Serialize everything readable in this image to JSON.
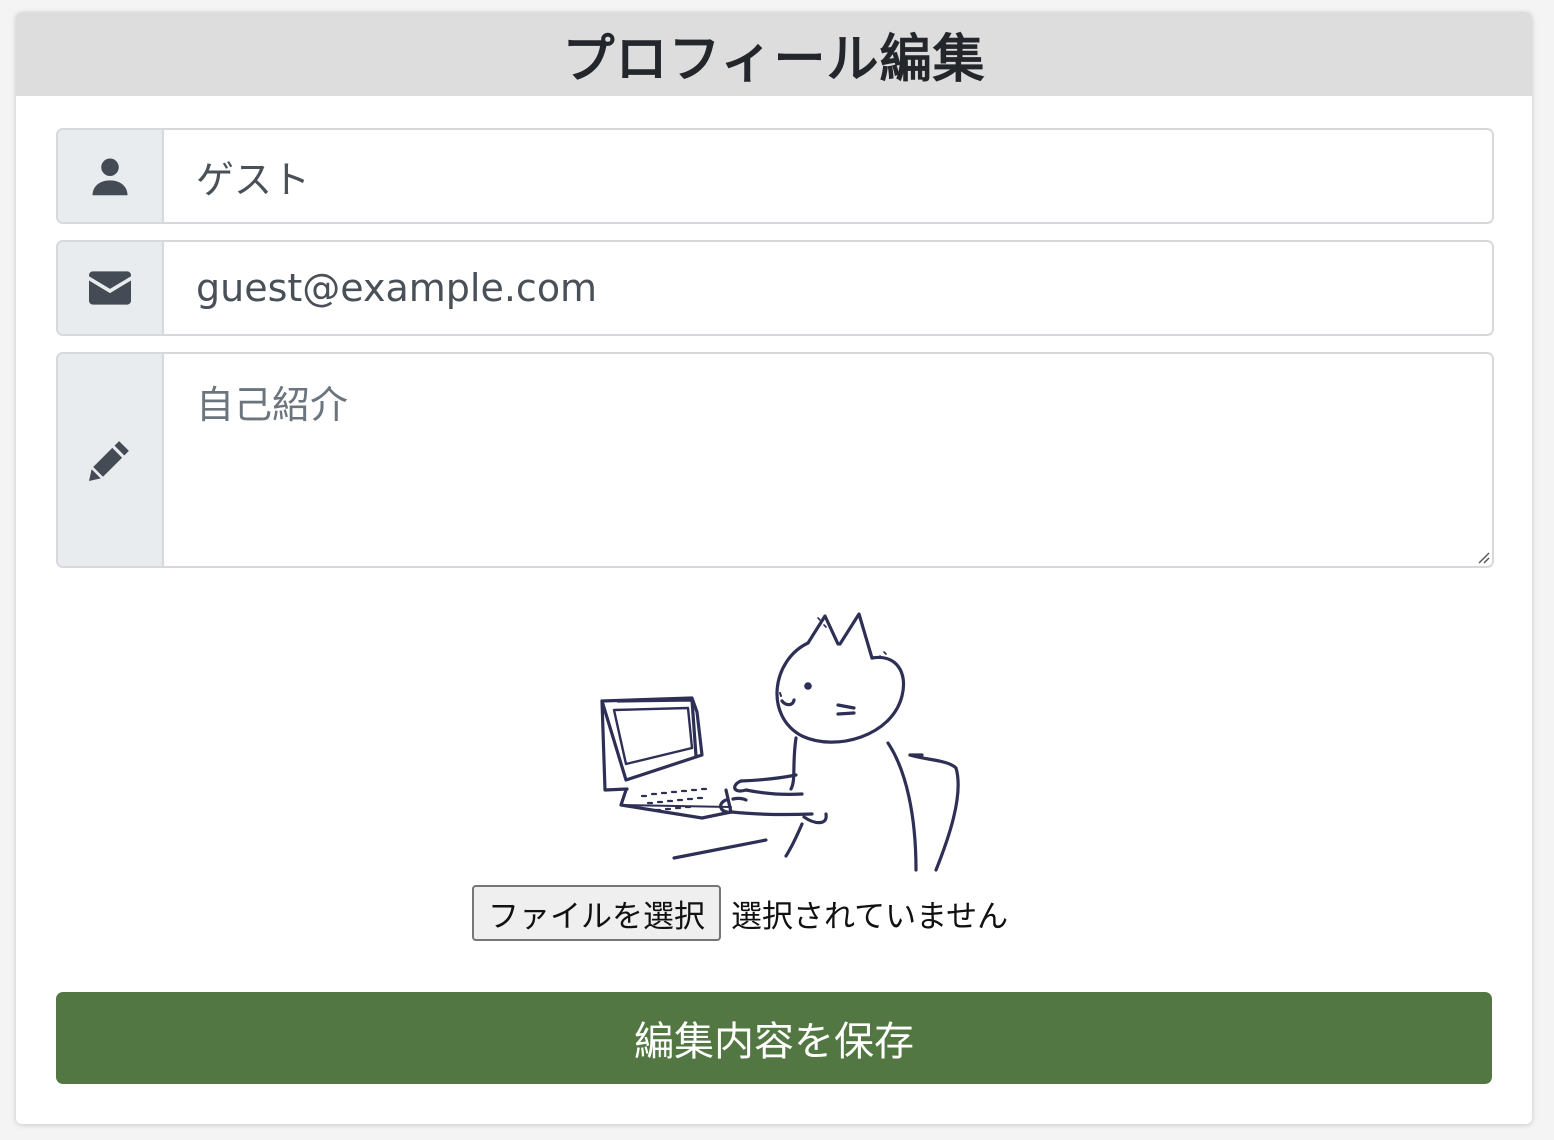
{
  "header": {
    "title": "プロフィール編集"
  },
  "form": {
    "name": {
      "value": "ゲスト",
      "icon": "user-icon"
    },
    "email": {
      "value": "guest@example.com",
      "icon": "envelope-icon"
    },
    "bio": {
      "value": "",
      "placeholder": "自己紹介",
      "icon": "pencil-icon"
    },
    "illustration": {
      "subject": "cat-using-laptop"
    },
    "file": {
      "button_label": "ファイルを選択",
      "status": "選択されていません"
    },
    "save_label": "編集内容を保存"
  },
  "colors": {
    "header_bg": "#dddddd",
    "addon_bg": "#e9ecef",
    "save_button": "#537743",
    "illustration_stroke": "#2e2f55"
  }
}
